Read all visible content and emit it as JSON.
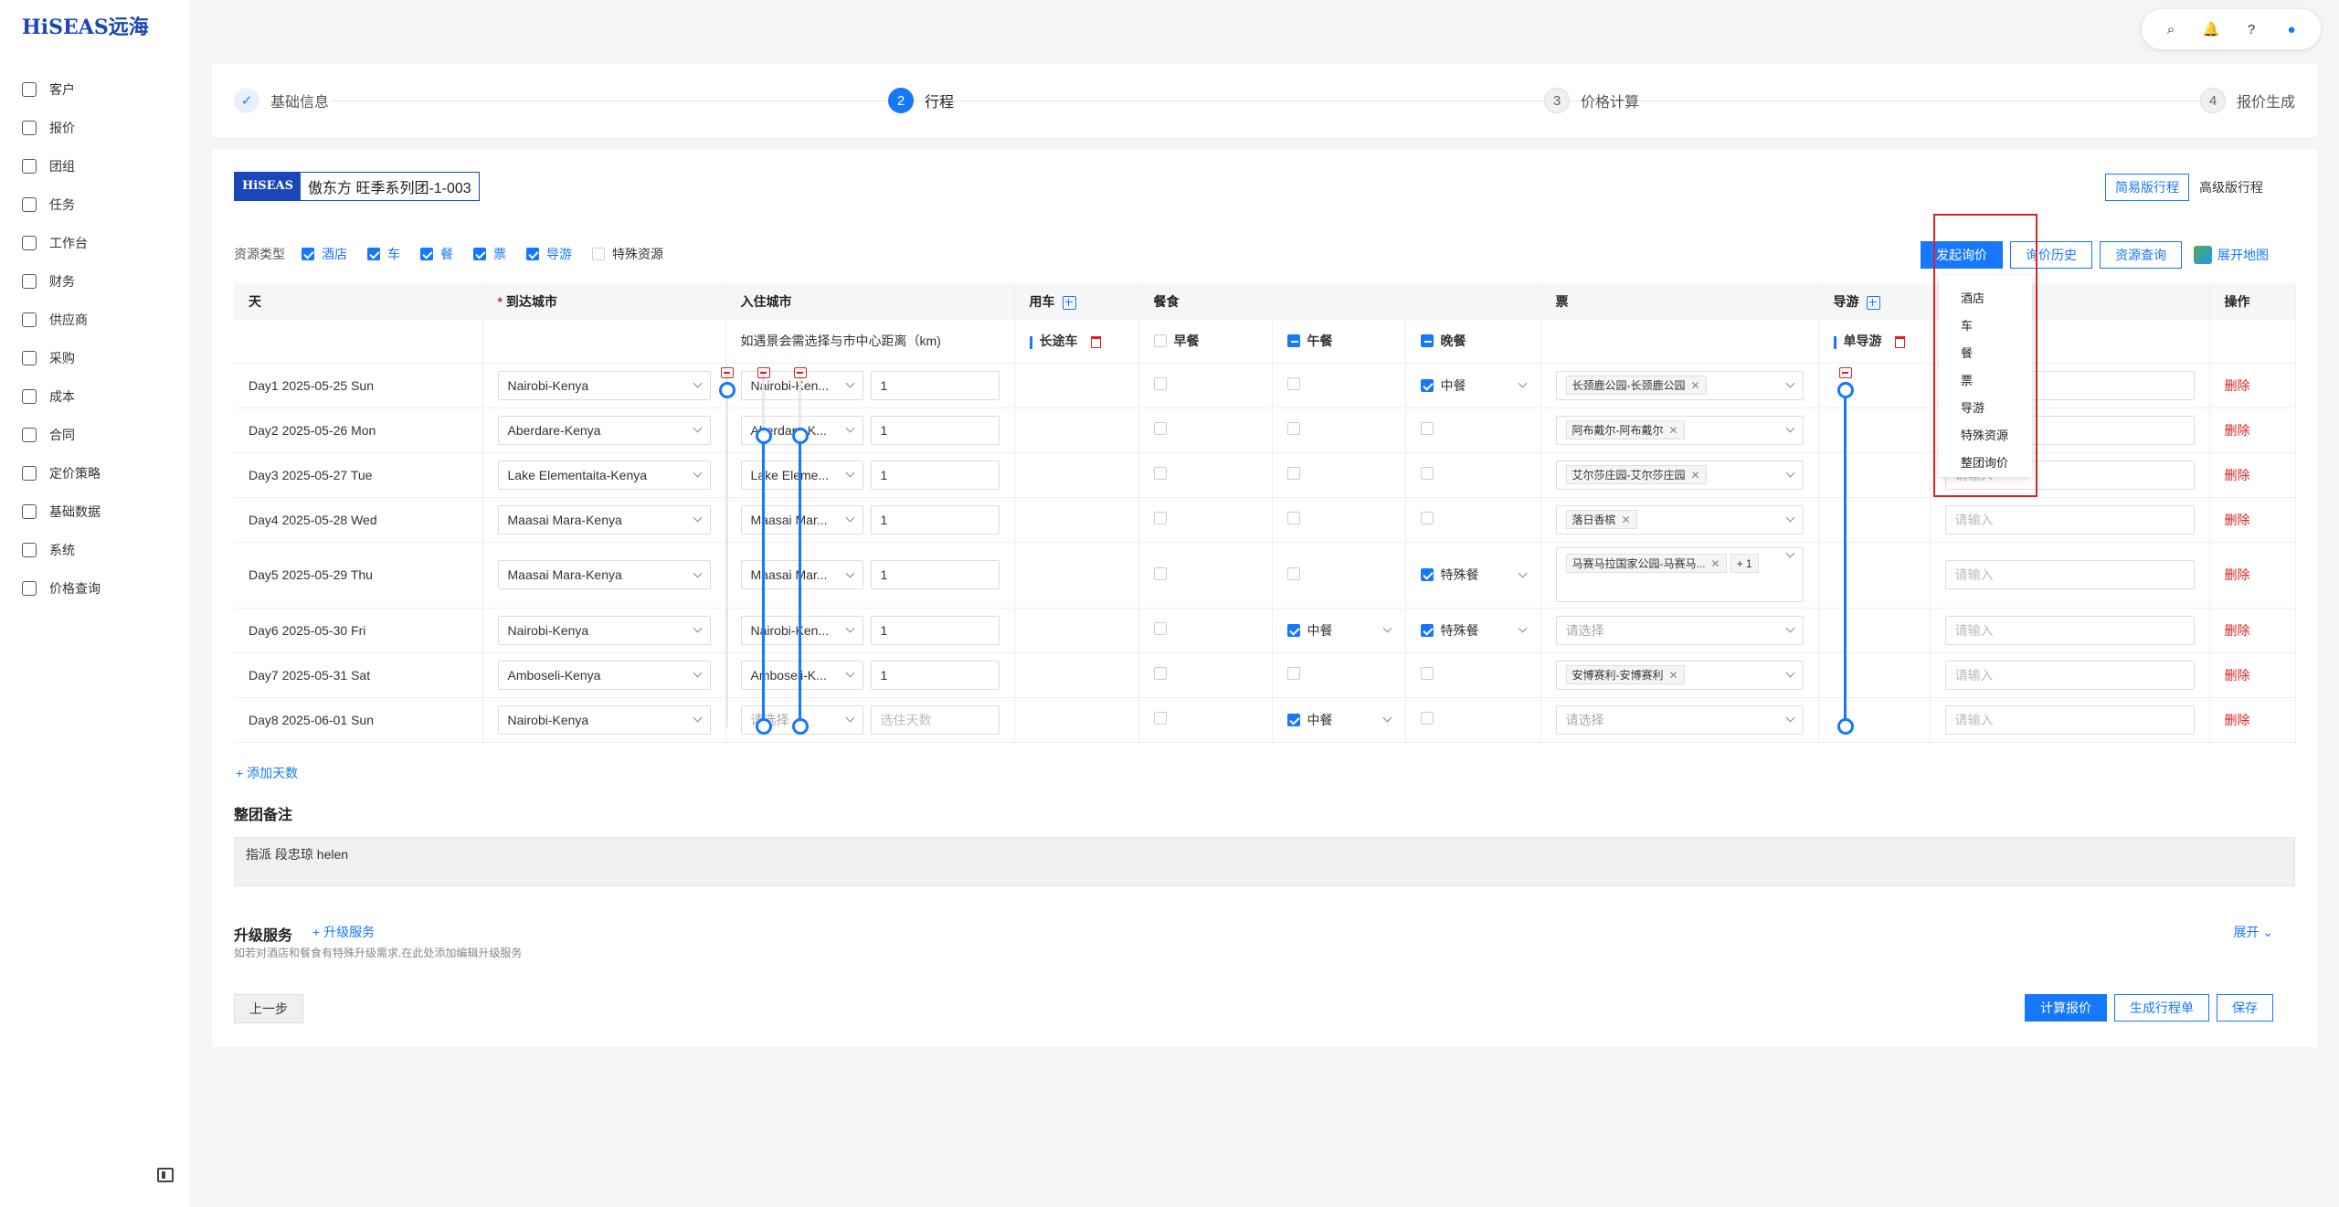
{
  "brand": {
    "logo": "HiSEAS远海",
    "badge": "HiSEAS"
  },
  "sidebar": {
    "items": [
      {
        "label": "客户",
        "icon": "customer-icon"
      },
      {
        "label": "报价",
        "icon": "quote-icon"
      },
      {
        "label": "团组",
        "icon": "group-icon"
      },
      {
        "label": "任务",
        "icon": "task-icon"
      },
      {
        "label": "工作台",
        "icon": "workbench-icon"
      },
      {
        "label": "财务",
        "icon": "finance-icon"
      },
      {
        "label": "供应商",
        "icon": "supplier-icon"
      },
      {
        "label": "采购",
        "icon": "purchase-icon"
      },
      {
        "label": "成本",
        "icon": "cost-icon"
      },
      {
        "label": "合同",
        "icon": "contract-icon"
      },
      {
        "label": "定价策略",
        "icon": "pricing-icon"
      },
      {
        "label": "基础数据",
        "icon": "basedata-icon"
      },
      {
        "label": "系统",
        "icon": "system-icon"
      },
      {
        "label": "价格查询",
        "icon": "price-search-icon"
      }
    ]
  },
  "steps": [
    {
      "num": "✓",
      "label": "基础信息",
      "state": "done"
    },
    {
      "num": "2",
      "label": "行程",
      "state": "active"
    },
    {
      "num": "3",
      "label": "价格计算",
      "state": "todo"
    },
    {
      "num": "4",
      "label": "报价生成",
      "state": "todo"
    }
  ],
  "group_title": "傲东方 旺季系列团-1-003",
  "view_toggle": {
    "simple": "简易版行程",
    "advanced": "高级版行程"
  },
  "resource_types": {
    "label": "资源类型",
    "items": [
      {
        "label": "酒店",
        "checked": true
      },
      {
        "label": "车",
        "checked": true
      },
      {
        "label": "餐",
        "checked": true
      },
      {
        "label": "票",
        "checked": true
      },
      {
        "label": "导游",
        "checked": true
      },
      {
        "label": "特殊资源",
        "checked": false
      }
    ]
  },
  "actions": {
    "inquiry": "发起询价",
    "history": "询价历史",
    "resource_query": "资源查询",
    "map": "展开地图"
  },
  "dropdown": [
    "酒店",
    "车",
    "餐",
    "票",
    "导游",
    "特殊资源",
    "整团询价"
  ],
  "table": {
    "headers": {
      "day": "天",
      "arrival": "到达城市",
      "stay": "入住城市",
      "car": "用车",
      "meal": "餐食",
      "ticket": "票",
      "guide": "导游",
      "op": "操作"
    },
    "sub": {
      "stay_hint": "如遇景会需选择与市中心距离（km)",
      "car": "长途车",
      "breakfast": "早餐",
      "lunch": "午餐",
      "dinner": "晚餐",
      "guide": "单导游"
    },
    "rows": [
      {
        "day": "Day1 2025-05-25 Sun",
        "arrival": "Nairobi-Kenya",
        "stay": "Nairobi-Ken...",
        "nights": "1",
        "lunch": "",
        "dinner": "中餐",
        "tickets": [
          "长颈鹿公园-长颈鹿公园"
        ],
        "more": "",
        "guide": "请输入",
        "op": "删除"
      },
      {
        "day": "Day2 2025-05-26 Mon",
        "arrival": "Aberdare-Kenya",
        "stay": "Aberdare-K...",
        "nights": "1",
        "lunch": "",
        "dinner": "",
        "tickets": [
          "阿布戴尔-阿布戴尔"
        ],
        "more": "",
        "guide": "请输入",
        "op": "删除"
      },
      {
        "day": "Day3 2025-05-27 Tue",
        "arrival": "Lake Elementaita-Kenya",
        "stay": "Lake Eleme...",
        "nights": "1",
        "lunch": "",
        "dinner": "",
        "tickets": [
          "艾尔莎庄园-艾尔莎庄园"
        ],
        "more": "",
        "guide": "请输入",
        "op": "删除"
      },
      {
        "day": "Day4 2025-05-28 Wed",
        "arrival": "Maasai Mara-Kenya",
        "stay": "Maasai Mar...",
        "nights": "1",
        "lunch": "",
        "dinner": "",
        "tickets": [
          "落日香槟"
        ],
        "more": "",
        "guide": "请输入",
        "op": "删除"
      },
      {
        "day": "Day5 2025-05-29 Thu",
        "arrival": "Maasai Mara-Kenya",
        "stay": "Maasai Mar...",
        "nights": "1",
        "lunch": "",
        "dinner": "特殊餐",
        "tickets": [
          "马赛马拉国家公园-马赛马..."
        ],
        "more": "+ 1",
        "guide": "请输入",
        "op": "删除"
      },
      {
        "day": "Day6 2025-05-30 Fri",
        "arrival": "Nairobi-Kenya",
        "stay": "Nairobi-Ken...",
        "nights": "1",
        "lunch": "中餐",
        "dinner": "特殊餐",
        "tickets": [],
        "more": "",
        "guide": "请输入",
        "op": "删除"
      },
      {
        "day": "Day7 2025-05-31 Sat",
        "arrival": "Amboseli-Kenya",
        "stay": "Amboseli-K...",
        "nights": "1",
        "lunch": "",
        "dinner": "",
        "tickets": [
          "安博赛利-安博赛利"
        ],
        "more": "",
        "guide": "请输入",
        "op": "删除"
      },
      {
        "day": "Day8 2025-06-01 Sun",
        "arrival": "Nairobi-Kenya",
        "stay": "",
        "nights": "",
        "lunch": "中餐",
        "dinner": "",
        "tickets": [],
        "more": "",
        "guide": "请输入",
        "op": "删除"
      }
    ],
    "placeholders": {
      "select": "请选择",
      "days": "选住天数",
      "input": "请输入"
    }
  },
  "add_days": "+ 添加天数",
  "remark": {
    "title": "整团备注",
    "content": "指派 段忠琼  helen"
  },
  "upgrade": {
    "title": "升级服务",
    "link": "+ 升级服务",
    "desc": "如若对酒店和餐食有特殊升级需求,在此处添加编辑升级服务",
    "expand": "展开"
  },
  "footer": {
    "prev": "上一步",
    "calc": "计算报价",
    "gen": "生成行程单",
    "save": "保存"
  }
}
